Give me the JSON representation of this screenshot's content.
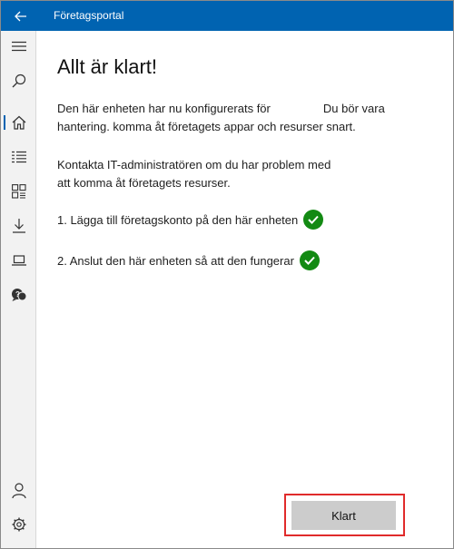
{
  "window": {
    "title": "Företagsportal",
    "accent_color": "#0063b1"
  },
  "sidebar": {
    "items": [
      {
        "icon": "hamburger-menu-icon"
      },
      {
        "icon": "search-icon"
      },
      {
        "icon": "home-icon",
        "active": true
      },
      {
        "icon": "list-icon"
      },
      {
        "icon": "apps-grid-icon"
      },
      {
        "icon": "download-icon"
      },
      {
        "icon": "laptop-icon"
      },
      {
        "icon": "help-chat-icon"
      },
      {
        "icon": "user-icon"
      },
      {
        "icon": "settings-gear-icon"
      }
    ]
  },
  "main": {
    "heading": "Allt är klart!",
    "paragraph1_a": "Den här enheten har nu konfigurerats för",
    "paragraph1_b": "Du bör vara",
    "paragraph1_c": "hantering. komma åt företagets appar och resurser snart.",
    "paragraph2_a": "Kontakta IT-administratören om du har problem med",
    "paragraph2_b": "att komma åt företagets resurser.",
    "steps": [
      {
        "label": "1. Lägga till företagskonto på den här enheten",
        "status": "complete"
      },
      {
        "label": "2. Anslut den här enheten så att den fungerar",
        "status": "complete"
      }
    ],
    "status_color": "#138a13",
    "done_button": "Klart",
    "highlight_color": "#e02b2b"
  }
}
